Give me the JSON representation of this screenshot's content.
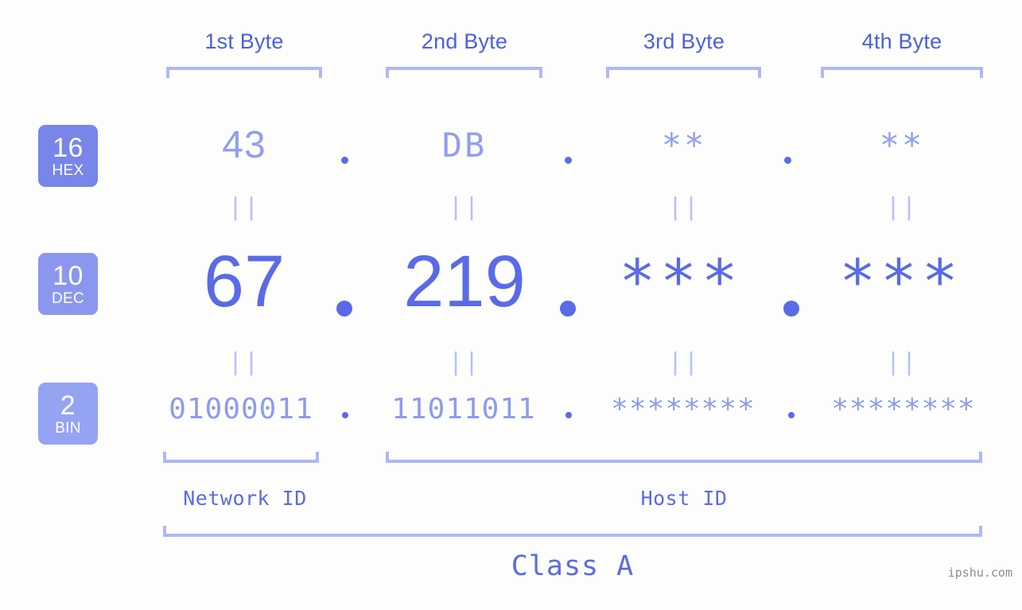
{
  "background_color": "#fdfefb",
  "accent_color": "#5a6ae8",
  "light_accent_color": "#aeb8f8",
  "byte_headers": [
    {
      "label": "1st Byte"
    },
    {
      "label": "2nd Byte"
    },
    {
      "label": "3rd Byte"
    },
    {
      "label": "4th Byte"
    }
  ],
  "bases": [
    {
      "number": "16",
      "name": "HEX",
      "color": "#7886ea"
    },
    {
      "number": "10",
      "name": "DEC",
      "color": "#8b97ef"
    },
    {
      "number": "2",
      "name": "BIN",
      "color": "#95a3f3"
    }
  ],
  "rows": {
    "hex": {
      "values": [
        "43",
        "DB",
        "**",
        "**"
      ],
      "separator": "."
    },
    "dec": {
      "values": [
        "67",
        "219",
        "***",
        "***"
      ],
      "separator": "."
    },
    "bin": {
      "values": [
        "01000011",
        "11011011",
        "********",
        "********"
      ],
      "separator": "."
    }
  },
  "equals_marks": [
    "||",
    "||",
    "||",
    "||"
  ],
  "segments": [
    {
      "label": "Network ID"
    },
    {
      "label": "Host ID"
    }
  ],
  "class": {
    "label": "Class A"
  },
  "watermark": {
    "text": "ipshu.com"
  }
}
